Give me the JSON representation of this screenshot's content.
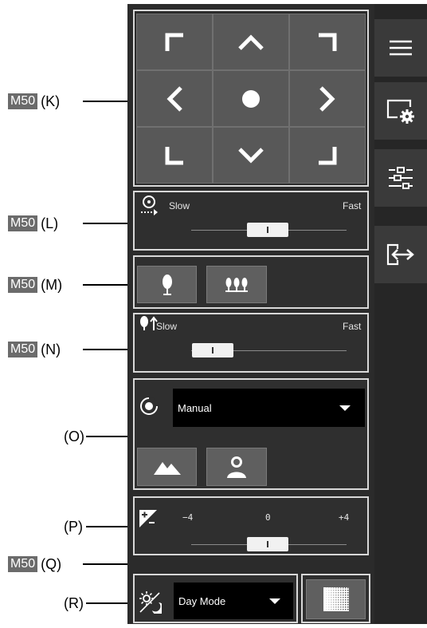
{
  "callouts": {
    "k": {
      "badge": "M50",
      "text": "(K)"
    },
    "l": {
      "badge": "M50",
      "text": "(L)"
    },
    "m": {
      "badge": "M50",
      "text": "(M)"
    },
    "n": {
      "badge": "M50",
      "text": "(N)"
    },
    "o": {
      "text": "(O)"
    },
    "p": {
      "text": "(P)"
    },
    "q": {
      "badge": "M50",
      "text": "(Q)"
    },
    "r": {
      "text": "(R)"
    }
  },
  "pan_speed": {
    "min_label": "Slow",
    "max_label": "Fast",
    "level": 0.55
  },
  "zoom_speed": {
    "min_label": "Slow",
    "max_label": "Fast",
    "level": 0.2
  },
  "focus": {
    "mode": "Manual"
  },
  "exposure": {
    "min_label": "−4",
    "mid_label": "0",
    "max_label": "+4",
    "level": 0.5
  },
  "day_night": {
    "mode": "Day Mode"
  },
  "colors": {
    "panel": "#2b2b2b",
    "pad": "#585858",
    "border": "#d8d8d8",
    "button": "#5f5f5f"
  },
  "icons": [
    "menu-icon",
    "display-settings-icon",
    "sliders-icon",
    "sign-in-icon"
  ]
}
